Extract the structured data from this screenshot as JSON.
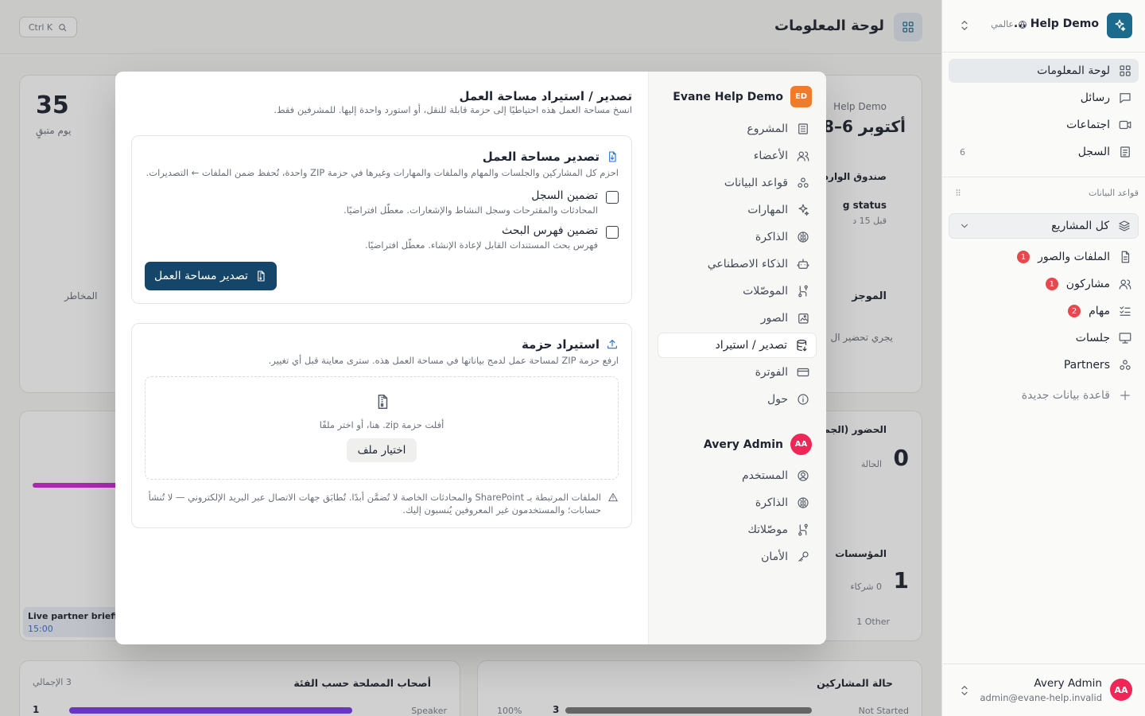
{
  "sidebar": {
    "workspace_name": "Help Demo ...",
    "scope_label": "عالمي",
    "nav": [
      {
        "label": "لوحة المعلومات",
        "icon": "dashboard-icon",
        "active": true
      },
      {
        "label": "رسائل",
        "icon": "message-icon"
      },
      {
        "label": "اجتماعات",
        "icon": "video-icon"
      },
      {
        "label": "السجل",
        "icon": "log-icon",
        "count": "6"
      }
    ],
    "databases_label": "قواعد البيانات",
    "project_select": "كل المشاريع",
    "db_items": [
      {
        "label": "الملفات والصور",
        "icon": "file-icon",
        "badge": "1"
      },
      {
        "label": "مشاركون",
        "icon": "users-icon",
        "badge": "1"
      },
      {
        "label": "مهام",
        "icon": "tasks-icon",
        "badge": "2"
      },
      {
        "label": "جلسات",
        "icon": "screen-icon",
        "badge": ""
      },
      {
        "label": "Partners",
        "icon": "cluster-icon",
        "badge": ""
      }
    ],
    "new_db_label": "قاعدة بيانات جديدة",
    "user": {
      "name": "Avery Admin",
      "email": "admin@evane-help.invalid",
      "initials": "AA"
    }
  },
  "topbar": {
    "title": "لوحة المعلومات",
    "search_shortcut": "Ctrl K"
  },
  "background": {
    "stat_value": "35",
    "stat_label": "يوم متبقٍ",
    "date_range": "أكتوبر 6–8",
    "brand_fragment": "Help Demo",
    "inbox_label": "صندوق الوارد",
    "status_label": "g status",
    "status_time": "قبل 15 د",
    "summary_label": "الموجز",
    "summary_text": "يجري تحضير ال",
    "risks_label": "المخاطر",
    "attendance_label": "الحضور (الجمه",
    "attendance_value": "0",
    "attendance_sub": "الحالة",
    "orgs_label": "المؤسسات",
    "orgs_value": "1",
    "orgs_sub": "0 شركاء",
    "orgs_other": "1 Other",
    "live_label": "Live partner briefi",
    "live_time": "15:00",
    "stakeholders_label": "أصحاب المصلحة حسب الفئة",
    "stakeholders_total": "3 الإجمالي",
    "speaker_label": "Speaker",
    "speaker_value": "1",
    "participants_label": "حالة المشاركين",
    "not_started_label": "Not Started",
    "not_started_value": "3",
    "pct_label": "100%"
  },
  "modal": {
    "workspace_title": "Evane Help Demo",
    "workspace_initials": "ED",
    "nav": [
      {
        "label": "المشروع",
        "icon": "building-icon"
      },
      {
        "label": "الأعضاء",
        "icon": "users-icon"
      },
      {
        "label": "قواعد البيانات",
        "icon": "cluster-icon"
      },
      {
        "label": "المهارات",
        "icon": "sparkle-icon"
      },
      {
        "label": "الذاكرة",
        "icon": "brain-icon"
      },
      {
        "label": "الذكاء الاصطناعي",
        "icon": "robot-icon"
      },
      {
        "label": "الموصّلات",
        "icon": "connector-icon"
      },
      {
        "label": "الصور",
        "icon": "image-icon"
      },
      {
        "label": "تصدير / استيراد",
        "icon": "database-export-icon",
        "active": true
      },
      {
        "label": "الفوترة",
        "icon": "card-icon"
      },
      {
        "label": "حول",
        "icon": "info-icon"
      }
    ],
    "user_name": "Avery Admin",
    "user_initials": "AA",
    "user_nav": [
      {
        "label": "المستخدم",
        "icon": "user-circle-icon"
      },
      {
        "label": "الذاكرة",
        "icon": "brain-icon"
      },
      {
        "label": "موصّلاتك",
        "icon": "connector-icon"
      },
      {
        "label": "الأمان",
        "icon": "key-icon"
      }
    ],
    "title": "تصدير / استيراد مساحة العمل",
    "subtitle": "انسخ مساحة العمل هذه احتياطيًا إلى حزمة قابلة للنقل، أو استورد واحدة إليها. للمشرفين فقط.",
    "export": {
      "title": "تصدير مساحة العمل",
      "description": "احزم كل المشاركين والجلسات والمهام والملفات والمهارات وغيرها في حزمة ZIP واحدة، تُحفظ ضمن الملفات ← التصديرات.",
      "options": [
        {
          "label": "تضمين السجل",
          "desc": "المحادثات والمقترحات وسجل النشاط والإشعارات. معطّل افتراضيًا."
        },
        {
          "label": "تضمين فهرس البحث",
          "desc": "فهرس بحث المستندات القابل لإعادة الإنشاء. معطّل افتراضيًا."
        }
      ],
      "button": "تصدير مساحة العمل"
    },
    "import": {
      "title": "استيراد حزمة",
      "description": "ارفع حزمة ZIP لمساحة عمل لدمج بياناتها في مساحة العمل هذه. سترى معاينة قبل أي تغيير.",
      "drop_text": "أفلت حزمة zip. هنا، أو اختر ملفًا",
      "choose_button": "اختيار ملف",
      "note_line1": "الملفات المرتبطة بـ SharePoint والمحادثات الخاصة لا تُضمَّن أبدًا. تُطابَق جهات الاتصال عبر البريد الإلكتروني — لا تُنشأ",
      "note_line2": "حسابات؛ والمستخدمون غير المعروفين يُنسبون إليك."
    }
  },
  "colors": {
    "primary": "#15466a",
    "brand": "#1c6b8c",
    "danger": "#e5484d",
    "avatar": "#f02656",
    "ws_chip": "#ef7b2d"
  }
}
